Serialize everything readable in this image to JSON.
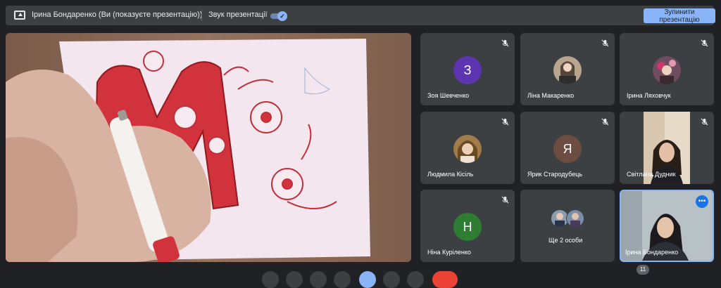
{
  "topbar": {
    "presenter_text": "Ірина Бондаренко (Ви (показуєте презентацію))",
    "sound_label": "Звук презентації",
    "stop_button": "Зупинити презентацію"
  },
  "participants": [
    {
      "name": "Зоя Шевченко",
      "initial": "З",
      "avatar_color": "#5e35b1",
      "muted": true
    },
    {
      "name": "Ліна Макаренко",
      "muted": true
    },
    {
      "name": "Ірина Ляховчук",
      "muted": true
    },
    {
      "name": "Людмила Кісіль",
      "muted": true
    },
    {
      "name": "Ярик Стародубець",
      "initial": "Я",
      "avatar_color": "#6d4c41",
      "muted": true
    },
    {
      "name": "Світлана Дудник",
      "muted": true
    },
    {
      "name": "Ніна Куріленко",
      "initial": "Н",
      "avatar_color": "#2e7d32",
      "muted": true
    },
    {
      "name": "Ще 2 особи"
    },
    {
      "name": "Ірина Бондаренко"
    }
  ],
  "participant_count": "11",
  "colors": {
    "accent": "#8ab4f8",
    "tile_bg": "#3c4043",
    "page_bg": "#202124"
  }
}
